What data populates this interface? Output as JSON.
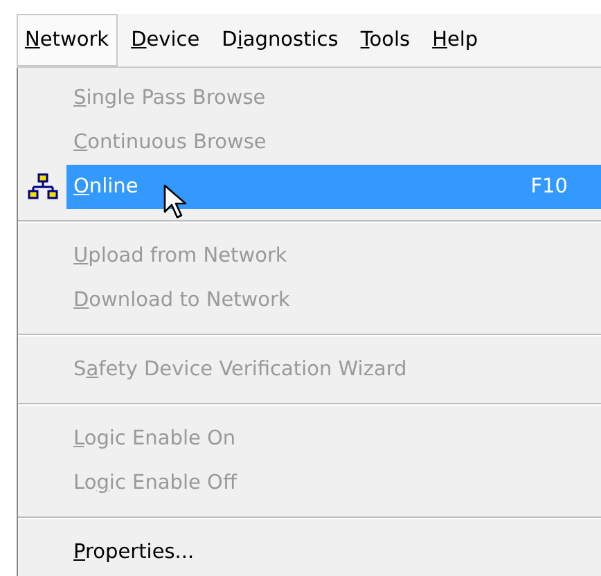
{
  "menu_bar": [
    {
      "label": {
        "key": "N",
        "after": "etwork"
      },
      "selected": true
    },
    {
      "label": {
        "key": "D",
        "after": "evice"
      },
      "selected": false
    },
    {
      "label": {
        "before": "D",
        "key": "i",
        "after": "agnostics"
      },
      "selected": false
    },
    {
      "label": {
        "key": "T",
        "after": "ools"
      },
      "selected": false
    },
    {
      "label": {
        "key": "H",
        "after": "elp"
      },
      "selected": false
    }
  ],
  "menu": [
    {
      "kind": "item",
      "label": {
        "key": "S",
        "after": "ingle Pass Browse"
      },
      "disabled": true,
      "selected": false
    },
    {
      "kind": "item",
      "label": {
        "key": "C",
        "after": "ontinuous Browse"
      },
      "disabled": true,
      "selected": false
    },
    {
      "kind": "icon_item",
      "label": {
        "key": "O",
        "after": "nline"
      },
      "shortcut": "F10",
      "disabled": false,
      "selected": true
    },
    {
      "kind": "separator"
    },
    {
      "kind": "item",
      "label": {
        "key": "U",
        "after": "pload from Network"
      },
      "disabled": true,
      "selected": false
    },
    {
      "kind": "item",
      "label": {
        "key": "D",
        "after": "ownload to Network"
      },
      "disabled": true,
      "selected": false
    },
    {
      "kind": "separator"
    },
    {
      "kind": "item",
      "label": {
        "before": "S",
        "key": "a",
        "after": "fety Device Verification Wizard"
      },
      "disabled": true,
      "selected": false
    },
    {
      "kind": "separator"
    },
    {
      "kind": "item",
      "label": {
        "key": "L",
        "after": "ogic Enable On"
      },
      "disabled": true,
      "selected": false
    },
    {
      "kind": "item",
      "label": {
        "before": "Lo",
        "key": "g",
        "after": "ic Enable Off"
      },
      "disabled": true,
      "selected": false
    },
    {
      "kind": "separator"
    },
    {
      "kind": "item",
      "label": {
        "key": "P",
        "after": "roperties..."
      },
      "disabled": false,
      "selected": false
    }
  ]
}
